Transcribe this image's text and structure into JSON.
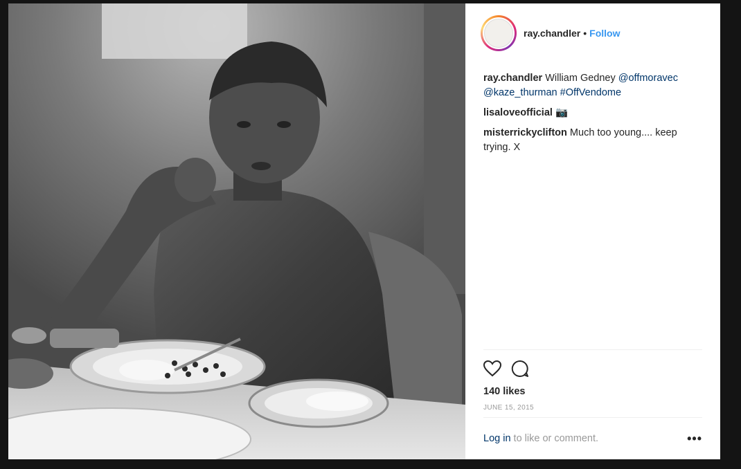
{
  "post": {
    "header": {
      "username": "ray.chandler",
      "separator": "•",
      "follow_label": "Follow"
    },
    "photo": {
      "alt": "Black and white photo of a shirtless boy seated at a table with plates of food",
      "style": "black-and-white"
    },
    "caption": {
      "username": "ray.chandler",
      "text": "William Gedney",
      "mention1": "@offmoravec",
      "mention2": "@kaze_thurman",
      "hashtag": "#OffVendome"
    },
    "comments": [
      {
        "username": "lisaloveofficial",
        "text": "📷"
      },
      {
        "username": "misterrickyclifton",
        "text": "Much too young.... keep trying. X"
      }
    ],
    "actions": {
      "like_icon": "heart-icon",
      "comment_icon": "comment-bubble-icon"
    },
    "likes": "140 likes",
    "date": "JUNE 15, 2015",
    "footer": {
      "login_label": "Log in",
      "login_suffix": " to like or comment.",
      "more_label": "•••"
    }
  },
  "colors": {
    "link_blue": "#3897f0",
    "link_dark": "#003569",
    "text": "#262626",
    "muted": "#999999",
    "backdrop": "#141414"
  }
}
